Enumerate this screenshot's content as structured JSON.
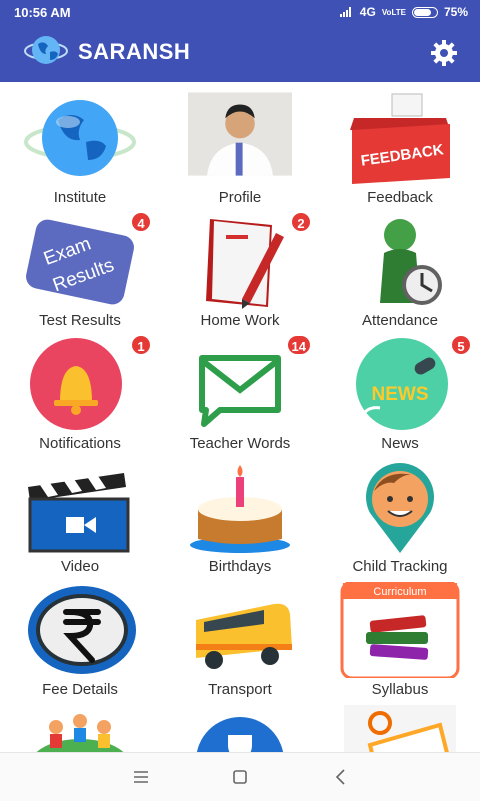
{
  "status": {
    "time": "10:56 AM",
    "network": "4G",
    "volte": "VoLTE",
    "battery": "75%"
  },
  "app": {
    "title": "SARANSH",
    "accent": "#3f51b5"
  },
  "tiles": [
    {
      "label": "Institute",
      "icon": "globe-icon"
    },
    {
      "label": "Profile",
      "icon": "profile-photo"
    },
    {
      "label": "Feedback",
      "icon": "feedback-box-icon",
      "image_text": "FEEDBACK"
    },
    {
      "label": "Test Results",
      "icon": "exam-results-icon",
      "badge": "4",
      "image_text": [
        "Exam",
        "Results"
      ]
    },
    {
      "label": "Home Work",
      "icon": "notebook-pen-icon",
      "badge": "2"
    },
    {
      "label": "Attendance",
      "icon": "person-clock-icon"
    },
    {
      "label": "Notifications",
      "icon": "bell-icon",
      "badge": "1"
    },
    {
      "label": "Teacher Words",
      "icon": "envelope-chat-icon",
      "badge": "14"
    },
    {
      "label": "News",
      "icon": "news-mic-icon",
      "badge": "5",
      "image_text": "NEWS"
    },
    {
      "label": "Video",
      "icon": "clapperboard-icon"
    },
    {
      "label": "Birthdays",
      "icon": "cake-icon"
    },
    {
      "label": "Child Tracking",
      "icon": "child-location-pin-icon"
    },
    {
      "label": "Fee Details",
      "icon": "rupee-coin-icon"
    },
    {
      "label": "Transport",
      "icon": "school-bus-icon"
    },
    {
      "label": "Syllabus",
      "icon": "books-icon",
      "image_text": "Curriculum"
    },
    {
      "label": "",
      "icon": "kids-globe-icon"
    },
    {
      "label": "",
      "icon": "trophy-icon"
    },
    {
      "label": "",
      "icon": "certificate-icon"
    }
  ]
}
